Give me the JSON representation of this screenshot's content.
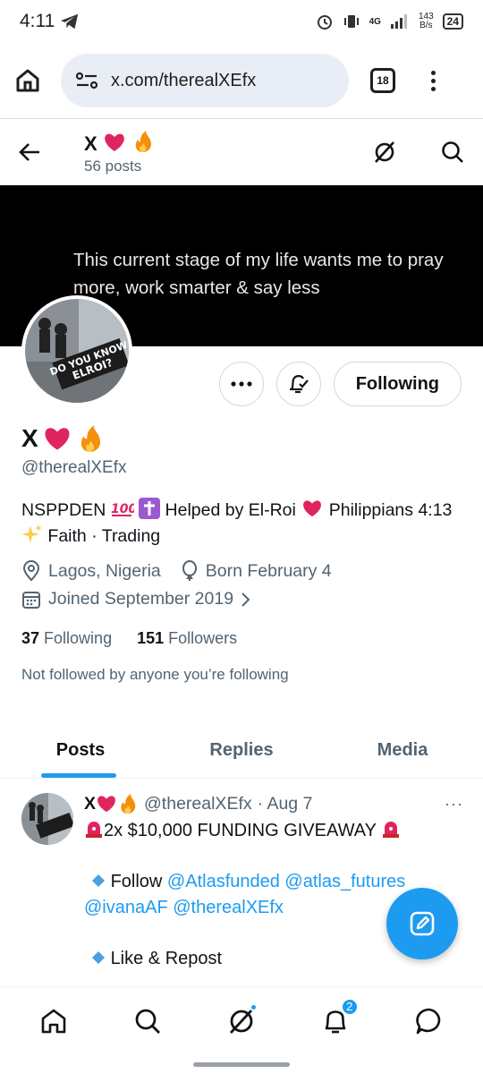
{
  "status_bar": {
    "time": "4:11",
    "network": "4G",
    "speed_value": "143",
    "speed_unit": "B/s",
    "battery": "24"
  },
  "browser": {
    "url": "x.com/therealXEfx",
    "tab_count": "18"
  },
  "header": {
    "name": "X",
    "posts_count": "56 posts"
  },
  "banner": {
    "text": "This current stage of my life wants me to pray more, work smarter & say less"
  },
  "avatar": {
    "sign_text": "DO YOU KNOW ELROI?"
  },
  "actions": {
    "following_label": "Following"
  },
  "profile": {
    "display_name": "X",
    "handle": "@therealXEfx",
    "bio_part1": "NSPPDEN",
    "bio_part2": "Helped by El-Roi",
    "bio_part3": "Philippians 4:13",
    "bio_part4": "Faith · Trading",
    "location": "Lagos, Nigeria",
    "birthday": "Born February 4",
    "joined": "Joined September 2019",
    "following_count": "37",
    "following_label": "Following",
    "followers_count": "151",
    "followers_label": "Followers",
    "not_followed": "Not followed by anyone you’re following"
  },
  "tabs": [
    {
      "label": "Posts"
    },
    {
      "label": "Replies"
    },
    {
      "label": "Media"
    }
  ],
  "post": {
    "name": "X",
    "handle": "@therealXEfx",
    "date": "· Aug 7",
    "more": "···",
    "headline": "2x $10,000 FUNDING GIVEAWAY",
    "follow_label": "Follow",
    "mention1": "@Atlasfunded",
    "mention2": "@atlas_futures",
    "mention3": "@ivanaAF",
    "mention4": "@therealXEfx",
    "like_repost": "Like & Repost"
  },
  "nav": {
    "notifications_badge": "2"
  },
  "colors": {
    "accent": "#1d9bf0",
    "text": "#0f1419",
    "muted": "#536471",
    "heart": "#e0245e"
  }
}
